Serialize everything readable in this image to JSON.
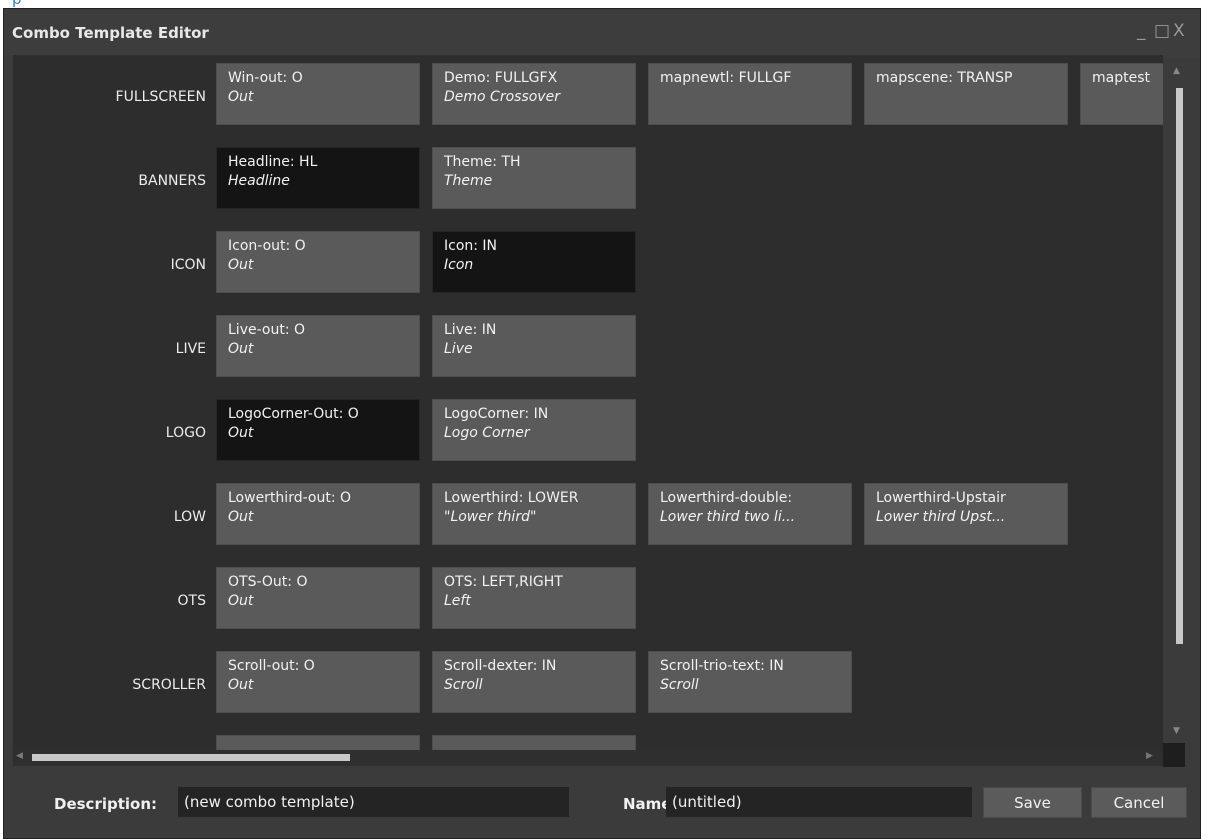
{
  "window": {
    "title": "Combo Template Editor",
    "minimize_glyph": "_",
    "maximize_glyph": "□",
    "close_glyph": "X"
  },
  "rows": [
    {
      "label": "FULLSCREEN",
      "tiles": [
        {
          "name": "Win-out: O",
          "desc": "Out",
          "selected": false
        },
        {
          "name": "Demo: FULLGFX",
          "desc": "Demo Crossover",
          "selected": false
        },
        {
          "name": "mapnewtl: FULLGF",
          "desc": "",
          "selected": false
        },
        {
          "name": "mapscene: TRANSP",
          "desc": "",
          "selected": false
        },
        {
          "name": "maptest",
          "desc": "",
          "selected": false
        }
      ]
    },
    {
      "label": "BANNERS",
      "tiles": [
        {
          "name": "Headline: HL",
          "desc": "Headline",
          "selected": true
        },
        {
          "name": "Theme: TH",
          "desc": "Theme",
          "selected": false
        }
      ]
    },
    {
      "label": "ICON",
      "tiles": [
        {
          "name": "Icon-out: O",
          "desc": "Out",
          "selected": false
        },
        {
          "name": "Icon: IN",
          "desc": "Icon",
          "selected": true
        }
      ]
    },
    {
      "label": "LIVE",
      "tiles": [
        {
          "name": "Live-out: O",
          "desc": "Out",
          "selected": false
        },
        {
          "name": "Live: IN",
          "desc": "Live",
          "selected": false
        }
      ]
    },
    {
      "label": "LOGO",
      "tiles": [
        {
          "name": "LogoCorner-Out: O",
          "desc": "Out",
          "selected": true
        },
        {
          "name": "LogoCorner: IN",
          "desc": "Logo Corner",
          "selected": false
        }
      ]
    },
    {
      "label": "LOW",
      "tiles": [
        {
          "name": "Lowerthird-out: O",
          "desc": "Out",
          "selected": false
        },
        {
          "name": "Lowerthird: LOWER",
          "desc": "\"Lower third\"",
          "selected": false
        },
        {
          "name": "Lowerthird-double:",
          "desc": "Lower third two li...",
          "selected": false
        },
        {
          "name": "Lowerthird-Upstair",
          "desc": "Lower third Upst...",
          "selected": false
        }
      ]
    },
    {
      "label": "OTS",
      "tiles": [
        {
          "name": "OTS-Out: O",
          "desc": "Out",
          "selected": false
        },
        {
          "name": "OTS: LEFT,RIGHT",
          "desc": "Left",
          "selected": false
        }
      ]
    },
    {
      "label": "SCROLLER",
      "tiles": [
        {
          "name": "Scroll-out: O",
          "desc": "Out",
          "selected": false
        },
        {
          "name": "Scroll-dexter: IN",
          "desc": "Scroll",
          "selected": false
        },
        {
          "name": "Scroll-trio-text: IN",
          "desc": "Scroll",
          "selected": false
        }
      ]
    },
    {
      "label": "",
      "tiles": [
        {
          "name": "",
          "desc": "",
          "selected": false
        },
        {
          "name": "",
          "desc": "",
          "selected": false
        }
      ]
    }
  ],
  "footer": {
    "description_label": "Description:",
    "description_value": "(new combo template)",
    "name_label": "Name:",
    "name_value": "(untitled)",
    "save_label": "Save",
    "cancel_label": "Cancel"
  }
}
